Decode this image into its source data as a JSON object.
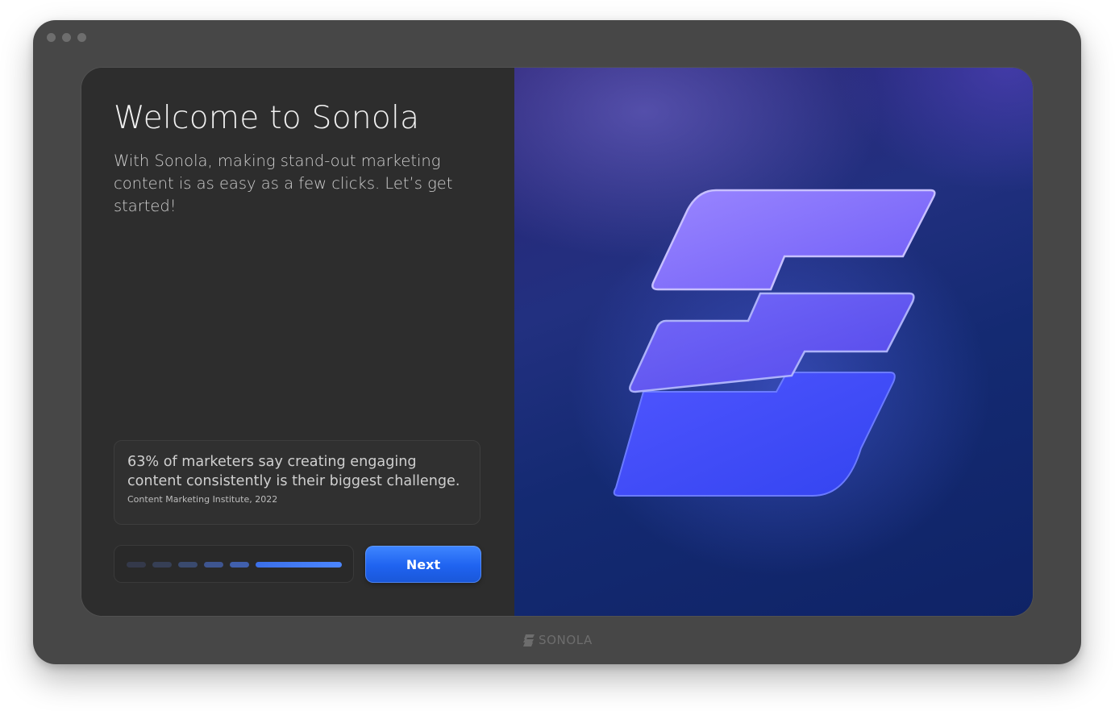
{
  "welcome": {
    "title": "Welcome to Sonola",
    "subtitle": "With Sonola, making stand-out marketing content is as easy as a few clicks. Let’s get started!"
  },
  "stat": {
    "text": "63% of marketers say creating engaging content consistently is their biggest challenge.",
    "source": "Content Marketing Institute, 2022"
  },
  "progress": {
    "total_steps": 6,
    "current_step": 6
  },
  "actions": {
    "next_label": "Next"
  },
  "footer": {
    "brand_name": "SONOLA"
  },
  "icons": {
    "hero": "sonola-logo-3d-icon",
    "footer": "sonola-logo-icon"
  },
  "colors": {
    "accent": "#2a6df5",
    "hero_gradient_start": "#2b2576",
    "hero_gradient_end": "#0f2366",
    "panel_dark": "#2d2d2d",
    "frame": "#474747"
  }
}
